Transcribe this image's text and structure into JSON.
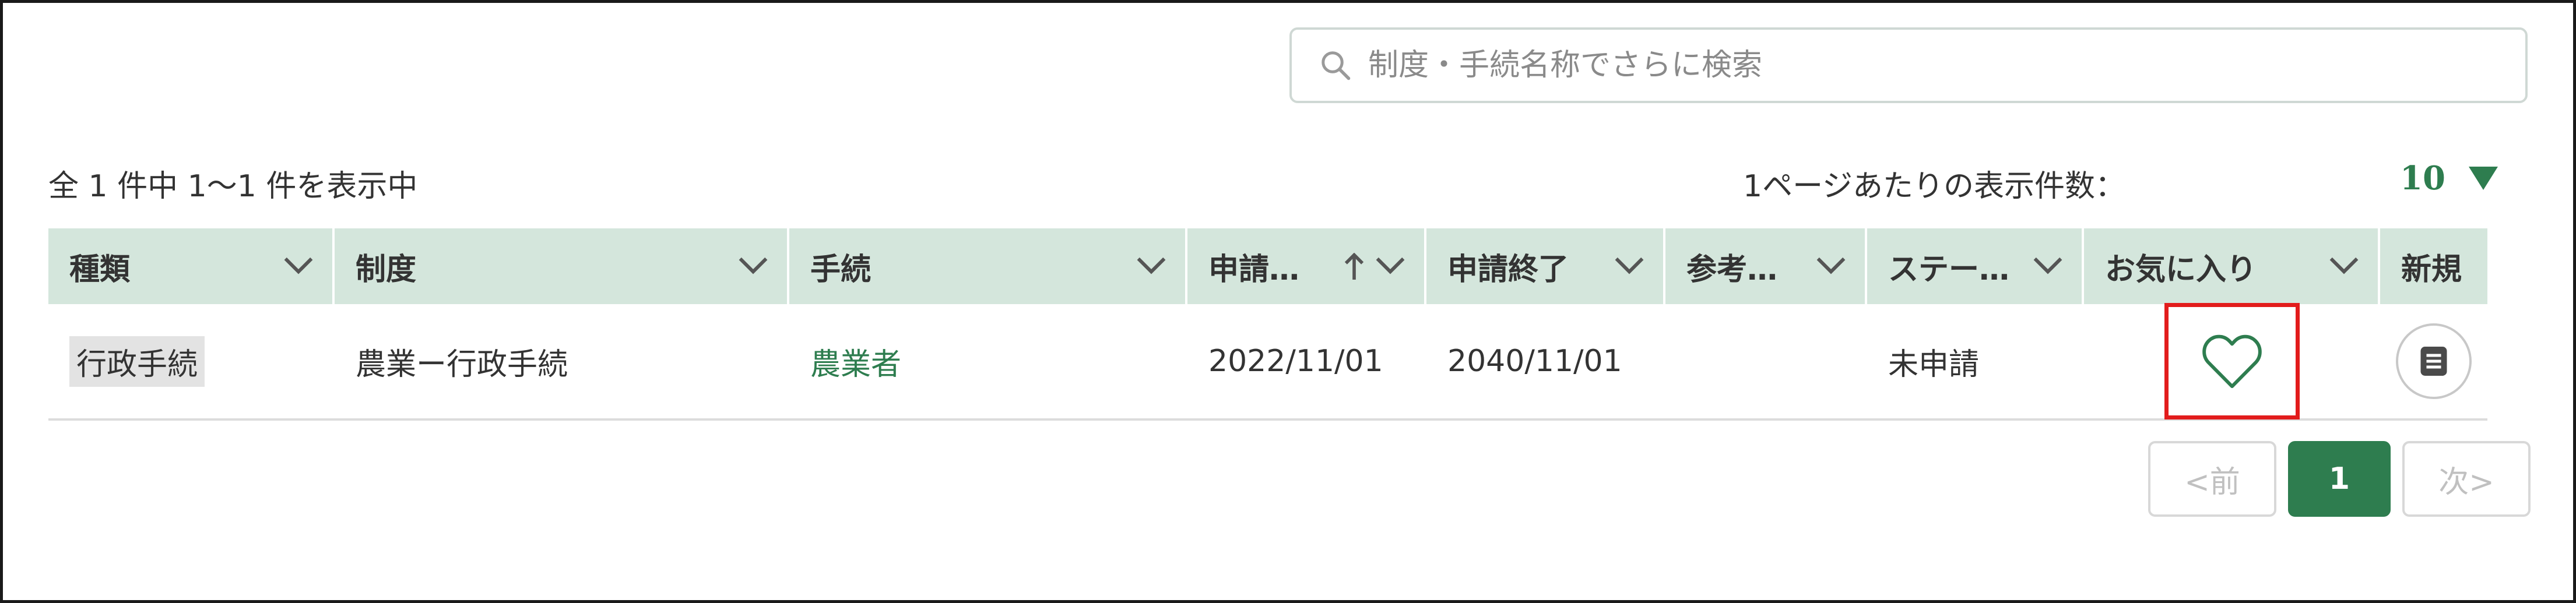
{
  "search": {
    "placeholder": "制度・手続名称でさらに検索",
    "icon": "search-icon"
  },
  "summary": {
    "count_text": "全 1 件中 1〜1 件を表示中",
    "per_page_label": "1ページあたりの表示件数：",
    "per_page_value": "10"
  },
  "table": {
    "headers": {
      "type": "種類",
      "system": "制度",
      "procedure": "手続",
      "apply_start": "申請…",
      "apply_end": "申請終了",
      "reference": "参考…",
      "status": "ステー…",
      "favorite": "お気に入り",
      "new": "新規"
    },
    "rows": [
      {
        "type": "行政手続",
        "system": "農業ー行政手続",
        "procedure": "農業者",
        "apply_start": "2022/11/01",
        "apply_end": "2040/11/01",
        "reference": "",
        "status": "未申請"
      }
    ]
  },
  "pagination": {
    "prev": "<前",
    "current": "1",
    "next": "次>"
  },
  "colors": {
    "accent": "#2e7d4f",
    "header_bg": "#d4e6dc",
    "highlight": "#e21c1c"
  }
}
